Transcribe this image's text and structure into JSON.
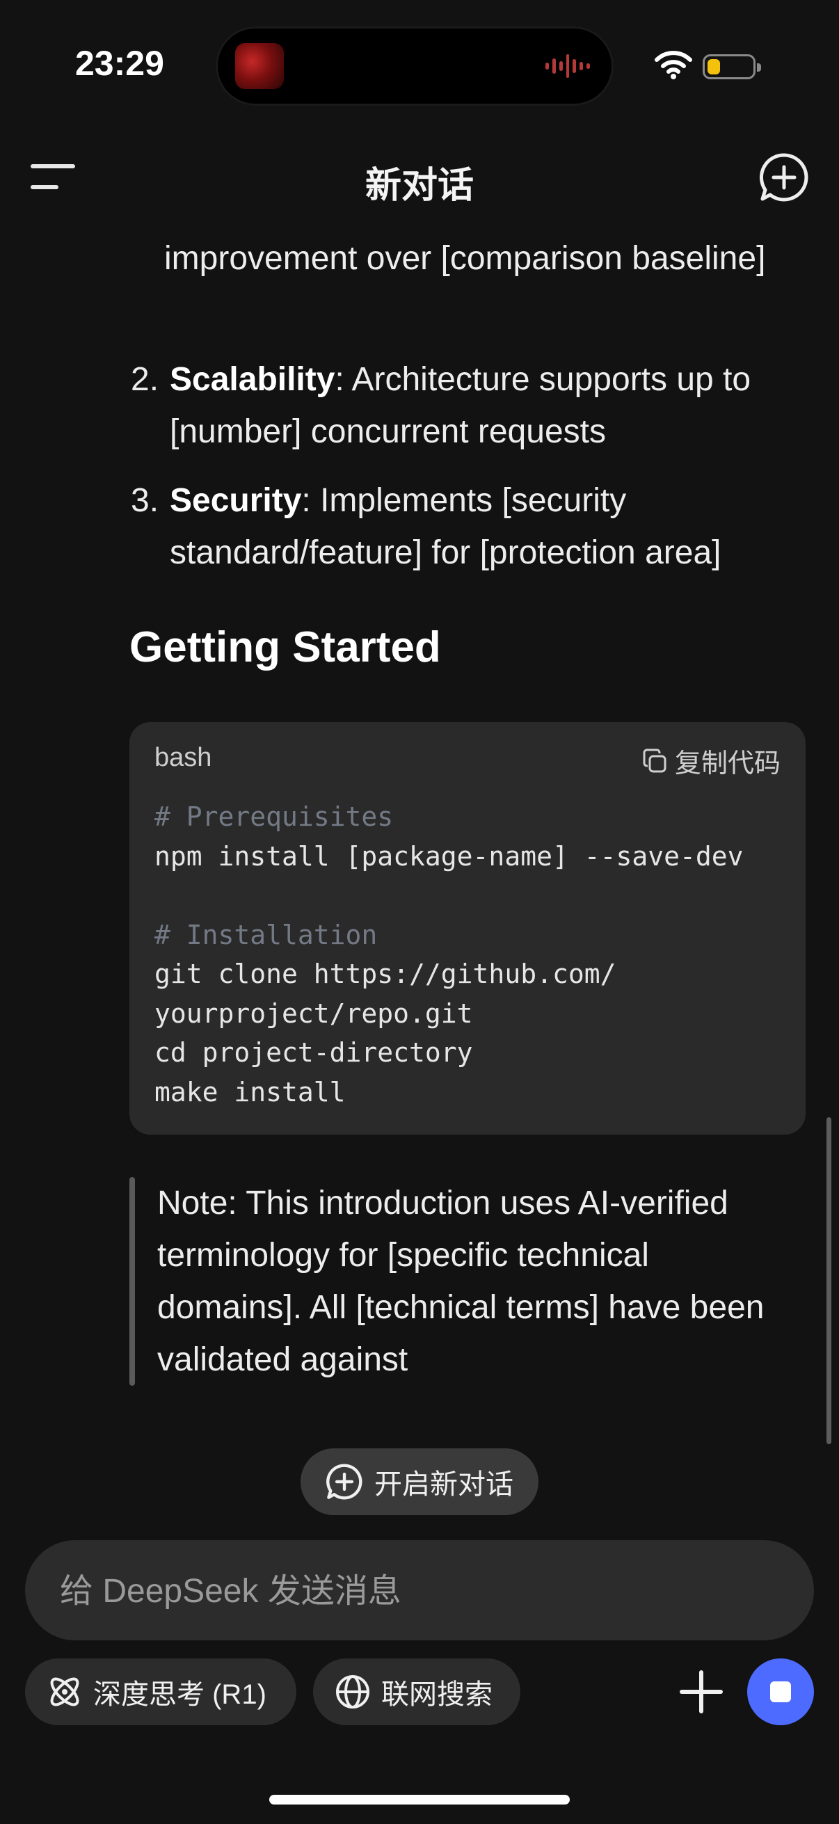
{
  "status_bar": {
    "time": "23:29",
    "battery_color": "#f4c20d"
  },
  "header": {
    "title": "新对话",
    "menu_icon": "menu-icon",
    "new_chat_icon": "new-chat-icon"
  },
  "message": {
    "continuation": "improvement over [comparison baseline]",
    "list_items": [
      {
        "number": "2.",
        "bold": "Scalability",
        "text": ": Architecture supports up to [number] concurrent requests"
      },
      {
        "number": "3.",
        "bold": "Security",
        "text": ": Implements [security standard/feature] for [protection area]"
      }
    ],
    "heading": "Getting Started",
    "code_block": {
      "language": "bash",
      "copy_label": "复制代码",
      "lines": [
        {
          "text": "# Prerequisites",
          "comment": true
        },
        {
          "text": "npm install [package-name] --save-dev",
          "comment": false
        },
        {
          "text": "",
          "comment": false
        },
        {
          "text": "# Installation",
          "comment": true
        },
        {
          "text": "git clone https://github.com/",
          "comment": false
        },
        {
          "text": "yourproject/repo.git",
          "comment": false
        },
        {
          "text": "cd project-directory",
          "comment": false
        },
        {
          "text": "make install",
          "comment": false
        }
      ]
    },
    "note": "Note: This introduction uses AI-verified terminology for [specific technical domains]. All [technical terms] have been validated against"
  },
  "new_conversation_button": "开启新对话",
  "composer": {
    "placeholder": "给 DeepSeek 发送消息",
    "deep_think_label": "深度思考 (R1)",
    "web_search_label": "联网搜索",
    "accent_color": "#4d6bfe"
  }
}
